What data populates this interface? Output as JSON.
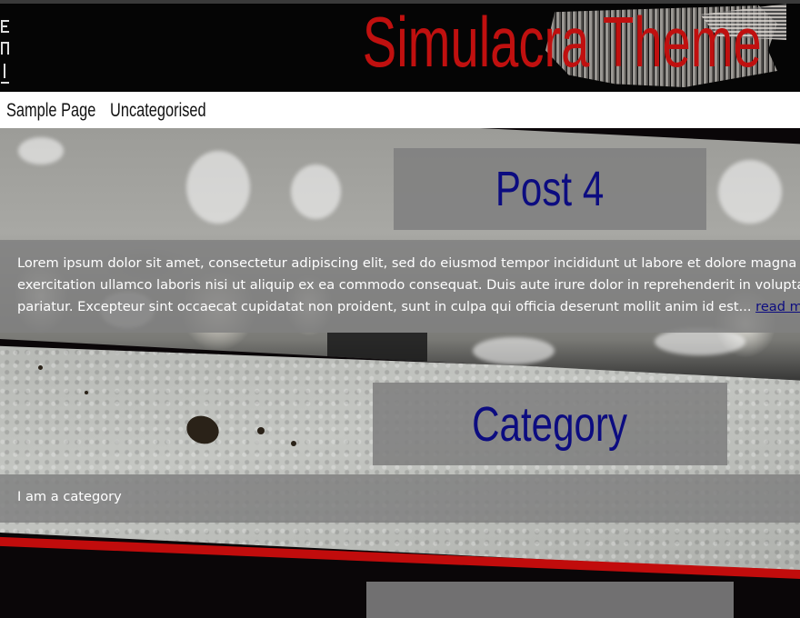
{
  "site": {
    "title": "Simulacra Theme",
    "title_color": "#c0100f",
    "side_text": "ERIA"
  },
  "nav": {
    "items": [
      {
        "label": "Sample Page"
      },
      {
        "label": "Uncategorised"
      }
    ]
  },
  "post": {
    "title": "Post 4",
    "excerpt_lines": [
      "Lorem ipsum dolor sit amet, consectetur adipiscing elit, sed do eiusmod tempor incididunt ut labore et dolore magna aliqu",
      "exercitation ullamco laboris nisi ut aliquip ex ea commodo consequat. Duis aute irure dolor in reprehenderit in voluptate ve",
      "pariatur. Excepteur sint occaecat cupidatat non proident, sunt in culpa qui officia deserunt mollit anim id est..."
    ],
    "read_more": "read more"
  },
  "category": {
    "title": "Category",
    "description": "I am a category"
  },
  "colors": {
    "heading": "#0c0c80",
    "accent_red": "#c10c0c",
    "box_gray": "#808080"
  }
}
